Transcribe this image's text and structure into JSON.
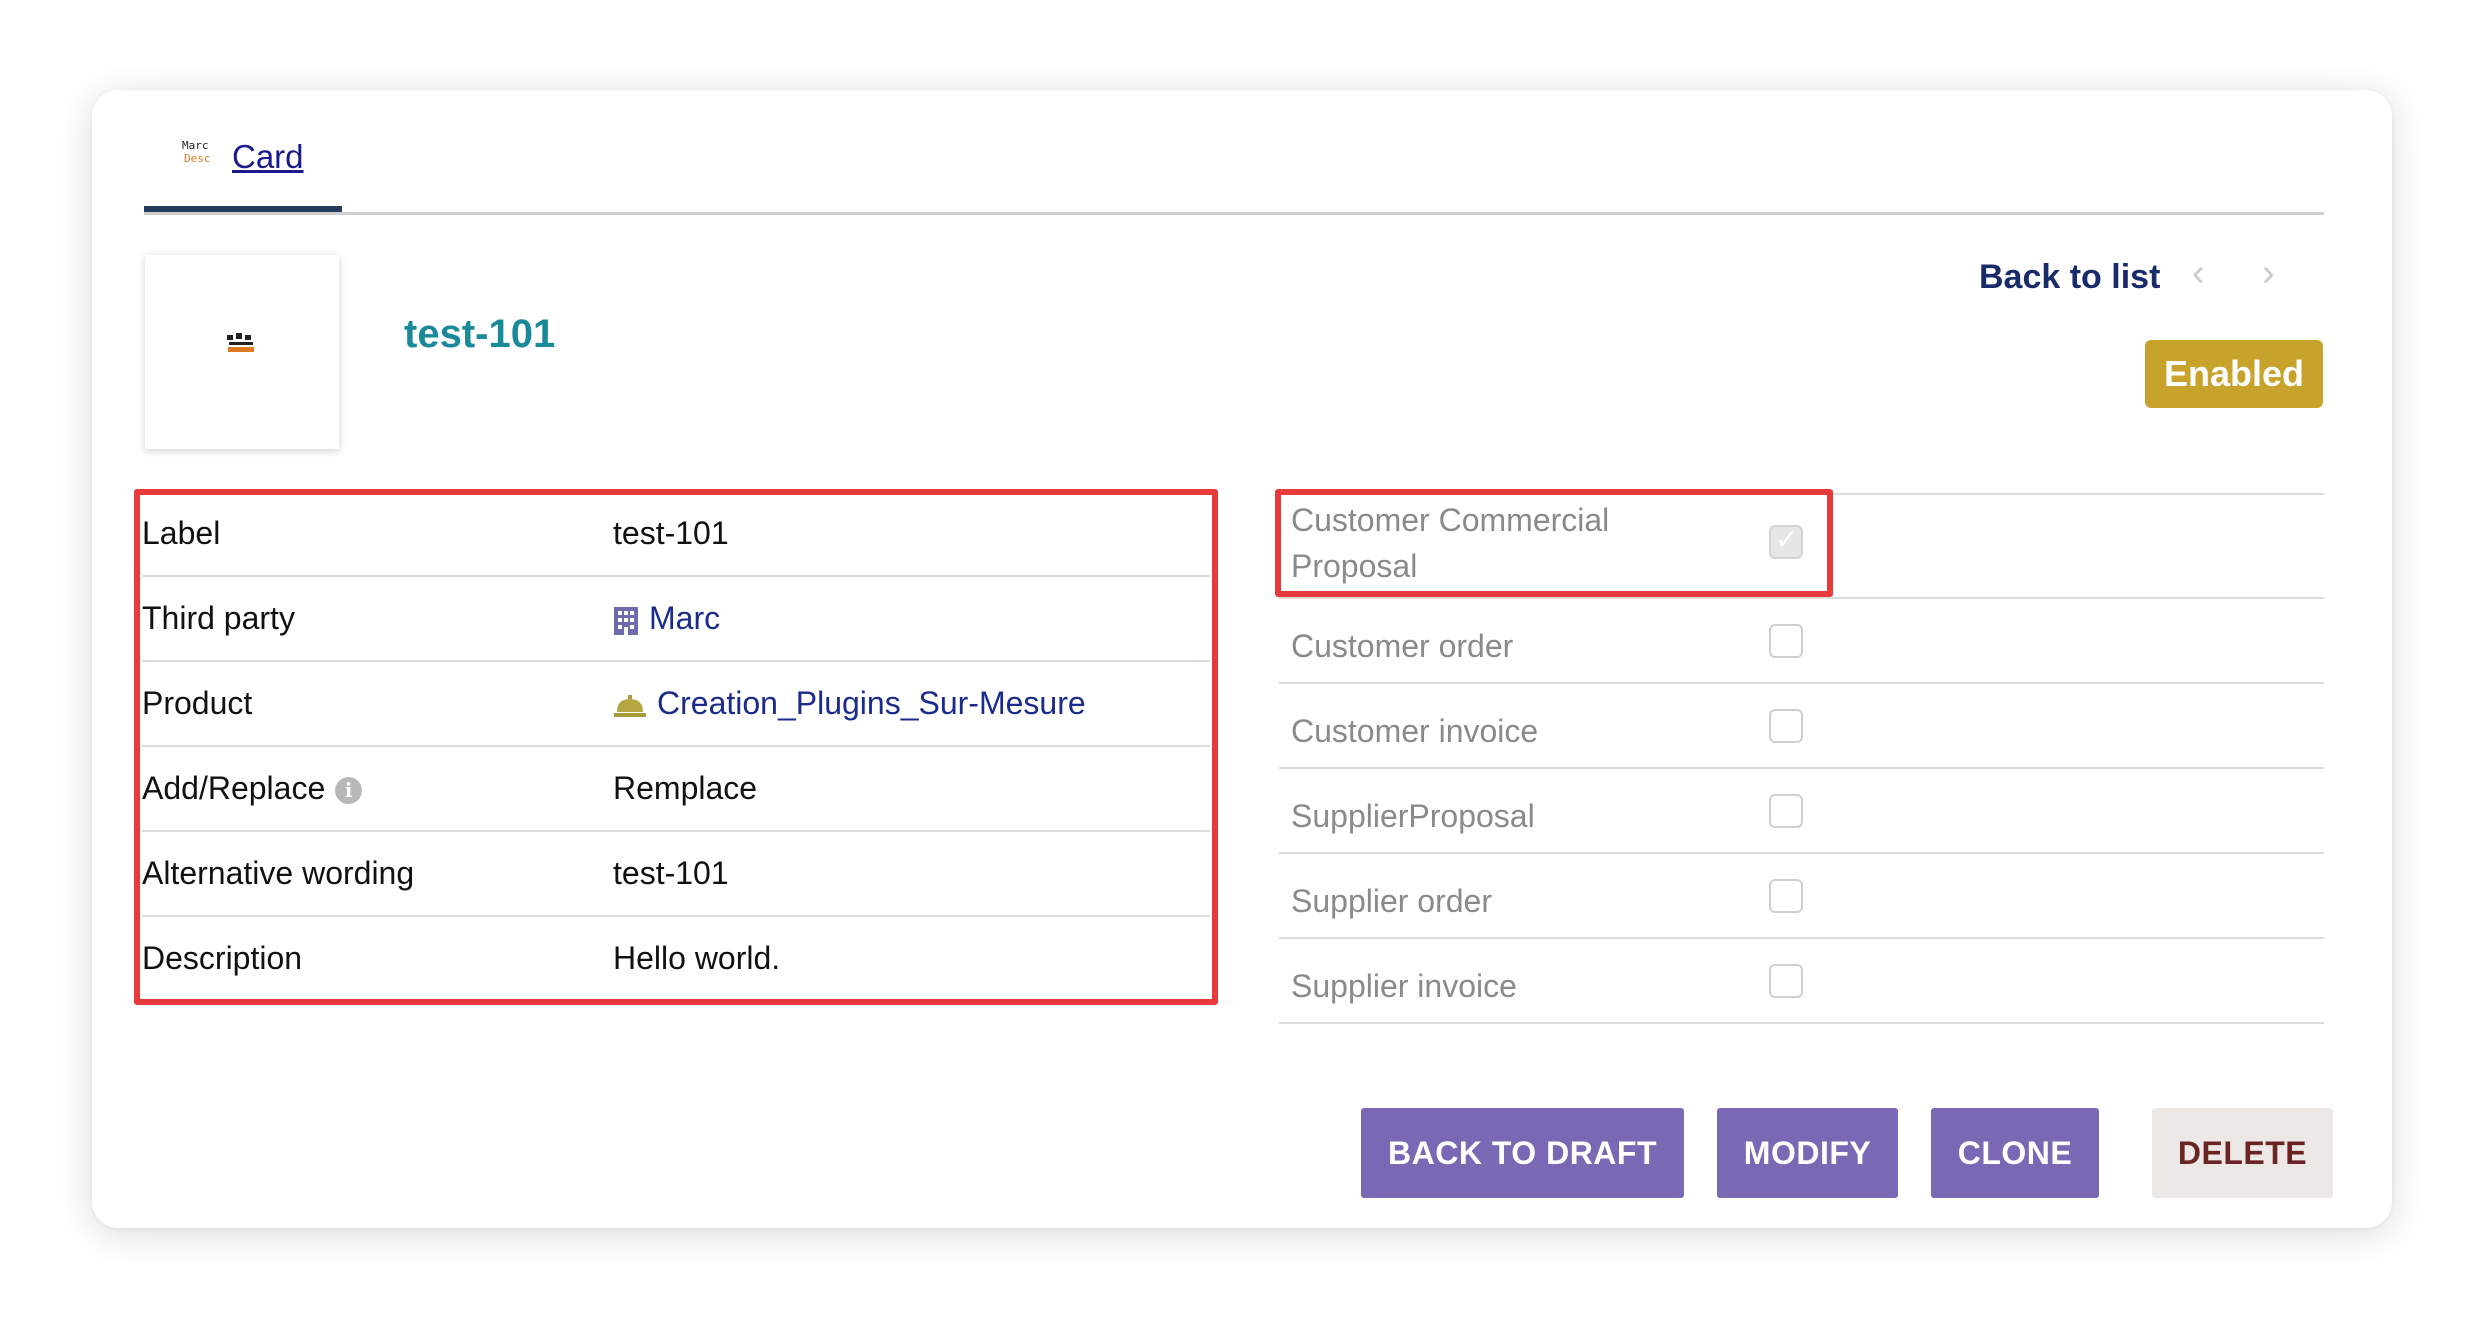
{
  "tabs": [
    {
      "label": "Card",
      "logo_line1": "Marc",
      "logo_line2": "Desc"
    }
  ],
  "header": {
    "ref": "test-101",
    "back_to_list": "Back to list",
    "prev_glyph": "‹",
    "next_glyph": "›",
    "status": "Enabled"
  },
  "fields": [
    {
      "label": "Label",
      "value": "test-101"
    },
    {
      "label": "Third party",
      "value": "Marc",
      "icon": "building-icon"
    },
    {
      "label": "Product",
      "value": "Creation_Plugins_Sur-Mesure",
      "icon": "service-bell-icon"
    },
    {
      "label": "Add/Replace",
      "value": "Remplace",
      "has_info": true
    },
    {
      "label": "Alternative wording",
      "value": "test-101"
    },
    {
      "label": "Description",
      "value": "Hello world."
    }
  ],
  "checkboxes": [
    {
      "label": "Customer Commercial Proposal",
      "checked": true
    },
    {
      "label": "Customer order",
      "checked": false
    },
    {
      "label": "Customer invoice",
      "checked": false
    },
    {
      "label": "SupplierProposal",
      "checked": false
    },
    {
      "label": "Supplier order",
      "checked": false
    },
    {
      "label": "Supplier invoice",
      "checked": false
    }
  ],
  "actions": {
    "back_to_draft": "BACK TO DRAFT",
    "modify": "MODIFY",
    "clone": "CLONE",
    "delete": "DELETE"
  },
  "colors": {
    "accent_purple": "#7b68b4",
    "status_gold": "#c8a32c",
    "highlight_red": "#e83a3a",
    "title_teal": "#1a8a9a",
    "link_navy": "#1a2b8c"
  }
}
